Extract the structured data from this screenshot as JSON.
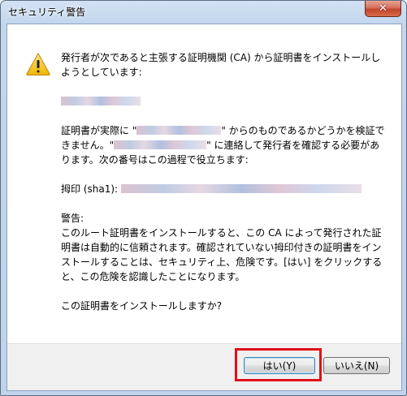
{
  "window": {
    "title": "セキュリティ警告"
  },
  "icons": {
    "close": "close-icon",
    "warning": "warning-icon"
  },
  "message": {
    "line1": "発行者が次であると主張する証明機関 (CA) から証明書をインストールしようとしています:",
    "para2_a": "証明書が実際に \"",
    "para2_b": "\" からのものであるかどうかを検証できません。\"",
    "para2_c": "\" に連絡して発行者を確認する必要があります。次の番号はこの過程で役立ちます:",
    "thumb_label": "拇印 (sha1):",
    "warning_title": "警告:",
    "warning_text": "このルート証明書をインストールすると、この CA によって発行された証明書は自動的に信頼されます。確認されていない拇印付きの証明書をインストールすることは、セキュリティ上、危険です。[はい] をクリックすると、この危険を認識したことになります。",
    "question": "この証明書をインストールしますか?"
  },
  "buttons": {
    "yes": "はい(Y)",
    "no": "いいえ(N)"
  },
  "colors": {
    "highlight": "#e01018",
    "title_bar": "#c2d6ee",
    "close_button": "#c0452d"
  }
}
